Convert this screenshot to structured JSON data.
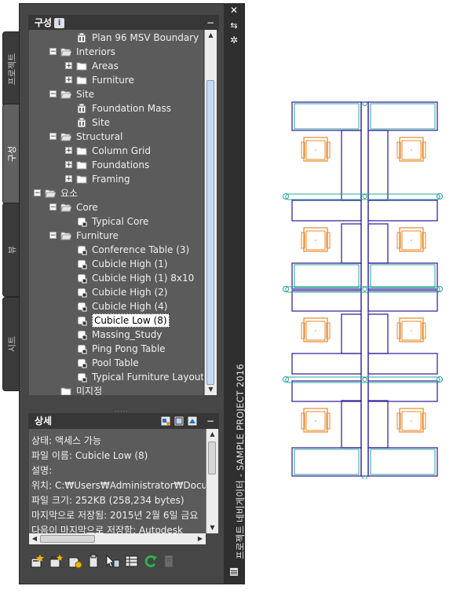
{
  "window": {
    "vertical_title": "프로젝트 네비게이터 - SAMPLE PROJECT 2016",
    "controls": {
      "close": "✕",
      "autohide": "⇆",
      "properties": "✲"
    }
  },
  "side_tabs": [
    {
      "label": "프로젝트"
    },
    {
      "label": "구성",
      "active": true
    },
    {
      "label": "뷰"
    },
    {
      "label": "시트"
    }
  ],
  "constructs_panel": {
    "title": "구성",
    "info_icon": "i",
    "minimize": "−",
    "tree": [
      {
        "label": "Plan 96 MSV Boundary"
      },
      {
        "label": "Interiors",
        "expander": "−"
      },
      {
        "label": "Areas",
        "expander": "+"
      },
      {
        "label": "Furniture",
        "expander": "+"
      },
      {
        "label": "Site",
        "expander": "−"
      },
      {
        "label": "Foundation Mass"
      },
      {
        "label": "Site"
      },
      {
        "label": "Structural",
        "expander": "−"
      },
      {
        "label": "Column Grid",
        "expander": "+"
      },
      {
        "label": "Foundations",
        "expander": "+"
      },
      {
        "label": "Framing",
        "expander": "+"
      },
      {
        "label": "요소",
        "expander": "−"
      },
      {
        "label": "Core",
        "expander": "−"
      },
      {
        "label": "Typical Core"
      },
      {
        "label": "Furniture",
        "expander": "−"
      },
      {
        "label": "Conference Table (3)"
      },
      {
        "label": "Cubicle High (1)"
      },
      {
        "label": "Cubicle High (1) 8x10"
      },
      {
        "label": "Cubicle High (2)"
      },
      {
        "label": "Cubicle High (4)"
      },
      {
        "label": "Cubicle Low (8)",
        "selected": true
      },
      {
        "label": "Massing_Study"
      },
      {
        "label": "Ping Pong Table"
      },
      {
        "label": "Pool Table"
      },
      {
        "label": "Typical Furniture Layout"
      },
      {
        "label": "미지정"
      }
    ],
    "splitter": "....."
  },
  "details_panel": {
    "title": "상세",
    "minimize": "−",
    "lines": [
      "상태: 액세스 가능",
      "파일 이름: Cubicle Low (8)",
      "설명:",
      "위치: C:₩Users₩Administrator₩Documen",
      "파일 크기: 252KB (258,234 bytes)",
      "마지막으로 저장됨: 2015년 2월 6일 금요",
      "다음이 마지막으로 저장함: Autodesk"
    ]
  },
  "toolbar_icons": [
    "new-element-icon",
    "new-category-icon",
    "add-construct-icon",
    "copy-to-project-icon",
    "select-filter-icon",
    "properties-grid-icon",
    "refresh-icon",
    "repath-icon"
  ],
  "colors": {
    "palette_bg": "#464646",
    "tree_bg": "#5b5b5b",
    "wall": "#3b2a9f",
    "furniture": "#e8872a",
    "detail": "#2aa39a"
  }
}
